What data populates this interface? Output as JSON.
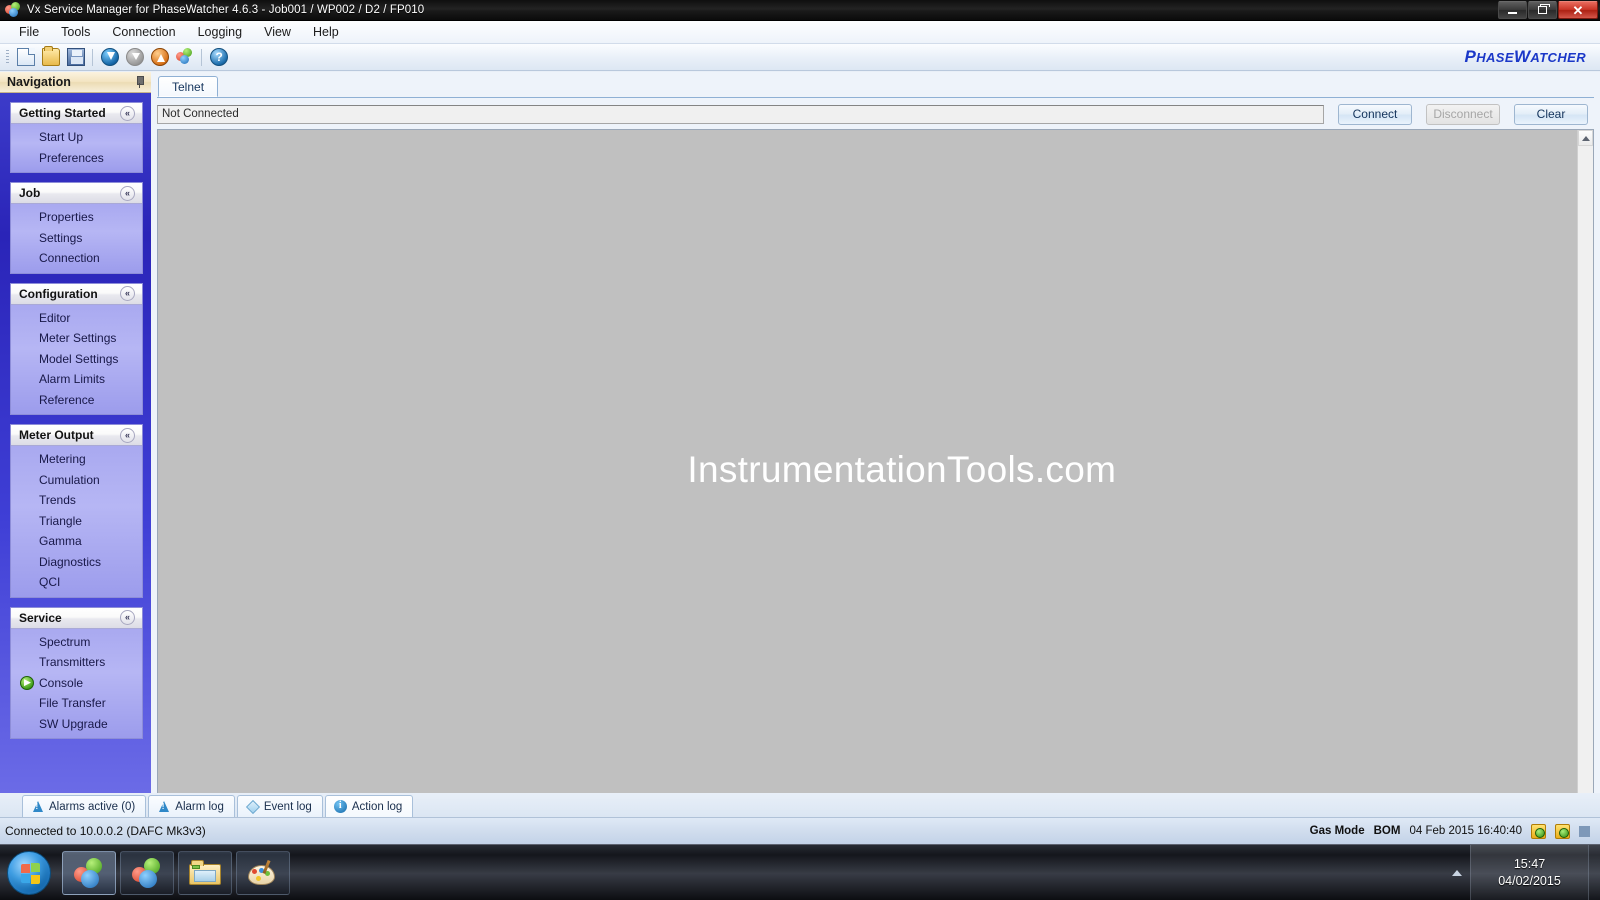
{
  "window": {
    "title": "Vx Service Manager for PhaseWatcher 4.6.3 - Job001 / WP002 / D2 / FP010",
    "minimize_label": "–",
    "maximize_label": "❐",
    "close_label": "✕"
  },
  "menu": {
    "items": [
      {
        "label": "File"
      },
      {
        "label": "Tools"
      },
      {
        "label": "Connection"
      },
      {
        "label": "Logging"
      },
      {
        "label": "View"
      },
      {
        "label": "Help"
      }
    ]
  },
  "toolbar": {
    "buttons": [
      {
        "name": "new-document-icon"
      },
      {
        "name": "open-folder-icon"
      },
      {
        "name": "save-icon"
      },
      {
        "name": "download-icon"
      },
      {
        "name": "print-disabled-icon"
      },
      {
        "name": "upload-icon"
      },
      {
        "name": "refresh-colors-icon"
      },
      {
        "name": "help-icon"
      }
    ],
    "brand": "PhaseWatcher",
    "brand_p": "P",
    "brand_hase": "HASE",
    "brand_w": "W",
    "brand_atcher": "ATCHER"
  },
  "navigation": {
    "title": "Navigation",
    "pin": "auto-hide-pin",
    "groups": [
      {
        "title": "Getting Started",
        "collapse": "«",
        "items": [
          {
            "label": "Start Up",
            "active": false
          },
          {
            "label": "Preferences",
            "active": false
          }
        ]
      },
      {
        "title": "Job",
        "collapse": "«",
        "items": [
          {
            "label": "Properties",
            "active": false
          },
          {
            "label": "Settings",
            "active": false
          },
          {
            "label": "Connection",
            "active": false
          }
        ]
      },
      {
        "title": "Configuration",
        "collapse": "«",
        "items": [
          {
            "label": "Editor",
            "active": false
          },
          {
            "label": "Meter Settings",
            "active": false
          },
          {
            "label": "Model Settings",
            "active": false
          },
          {
            "label": "Alarm Limits",
            "active": false
          },
          {
            "label": "Reference",
            "active": false
          }
        ]
      },
      {
        "title": "Meter Output",
        "collapse": "«",
        "items": [
          {
            "label": "Metering",
            "active": false
          },
          {
            "label": "Cumulation",
            "active": false
          },
          {
            "label": "Trends",
            "active": false
          },
          {
            "label": "Triangle",
            "active": false
          },
          {
            "label": "Gamma",
            "active": false
          },
          {
            "label": "Diagnostics",
            "active": false
          },
          {
            "label": "QCI",
            "active": false
          }
        ]
      },
      {
        "title": "Service",
        "collapse": "«",
        "items": [
          {
            "label": "Spectrum",
            "active": false
          },
          {
            "label": "Transmitters",
            "active": false
          },
          {
            "label": "Console",
            "active": true
          },
          {
            "label": "File Transfer",
            "active": false
          },
          {
            "label": "SW Upgrade",
            "active": false
          }
        ]
      }
    ]
  },
  "content": {
    "tabs": [
      {
        "label": "Telnet",
        "active": true
      }
    ],
    "connection_status": "Not Connected",
    "buttons": {
      "connect": "Connect",
      "disconnect": "Disconnect",
      "clear": "Clear"
    },
    "console_watermark": "InstrumentationTools.com",
    "scroll_up": "▲",
    "scroll_down": "▼"
  },
  "log_tabs": [
    {
      "label": "Alarms active (0)",
      "icon": "alarm-icon",
      "active": false
    },
    {
      "label": "Alarm log",
      "icon": "alarm-icon",
      "active": false
    },
    {
      "label": "Event log",
      "icon": "diamond-icon",
      "active": false
    },
    {
      "label": "Action log",
      "icon": "info-icon",
      "active": true
    }
  ],
  "status_bar": {
    "connection": "Connected to 10.0.0.2 (DAFC Mk3v3)",
    "gas_mode_label": "Gas Mode",
    "gas_mode_value": "BOM",
    "datetime": "04 Feb 2015 16:40:40"
  },
  "taskbar": {
    "start": "start-orb",
    "apps": [
      {
        "name": "vx-service-manager-1",
        "active": true
      },
      {
        "name": "vx-service-manager-2",
        "active": false
      },
      {
        "name": "windows-explorer",
        "active": false
      },
      {
        "name": "paint",
        "active": false
      }
    ],
    "tray_expand": "show-hidden-icons",
    "clock_time": "15:47",
    "clock_date": "04/02/2015"
  },
  "colors": {
    "brand_blue": "#1b38c8",
    "nav_purple": "#b6b6f4",
    "console_gray": "#c0c0c0",
    "accent": "#2a24b8"
  }
}
